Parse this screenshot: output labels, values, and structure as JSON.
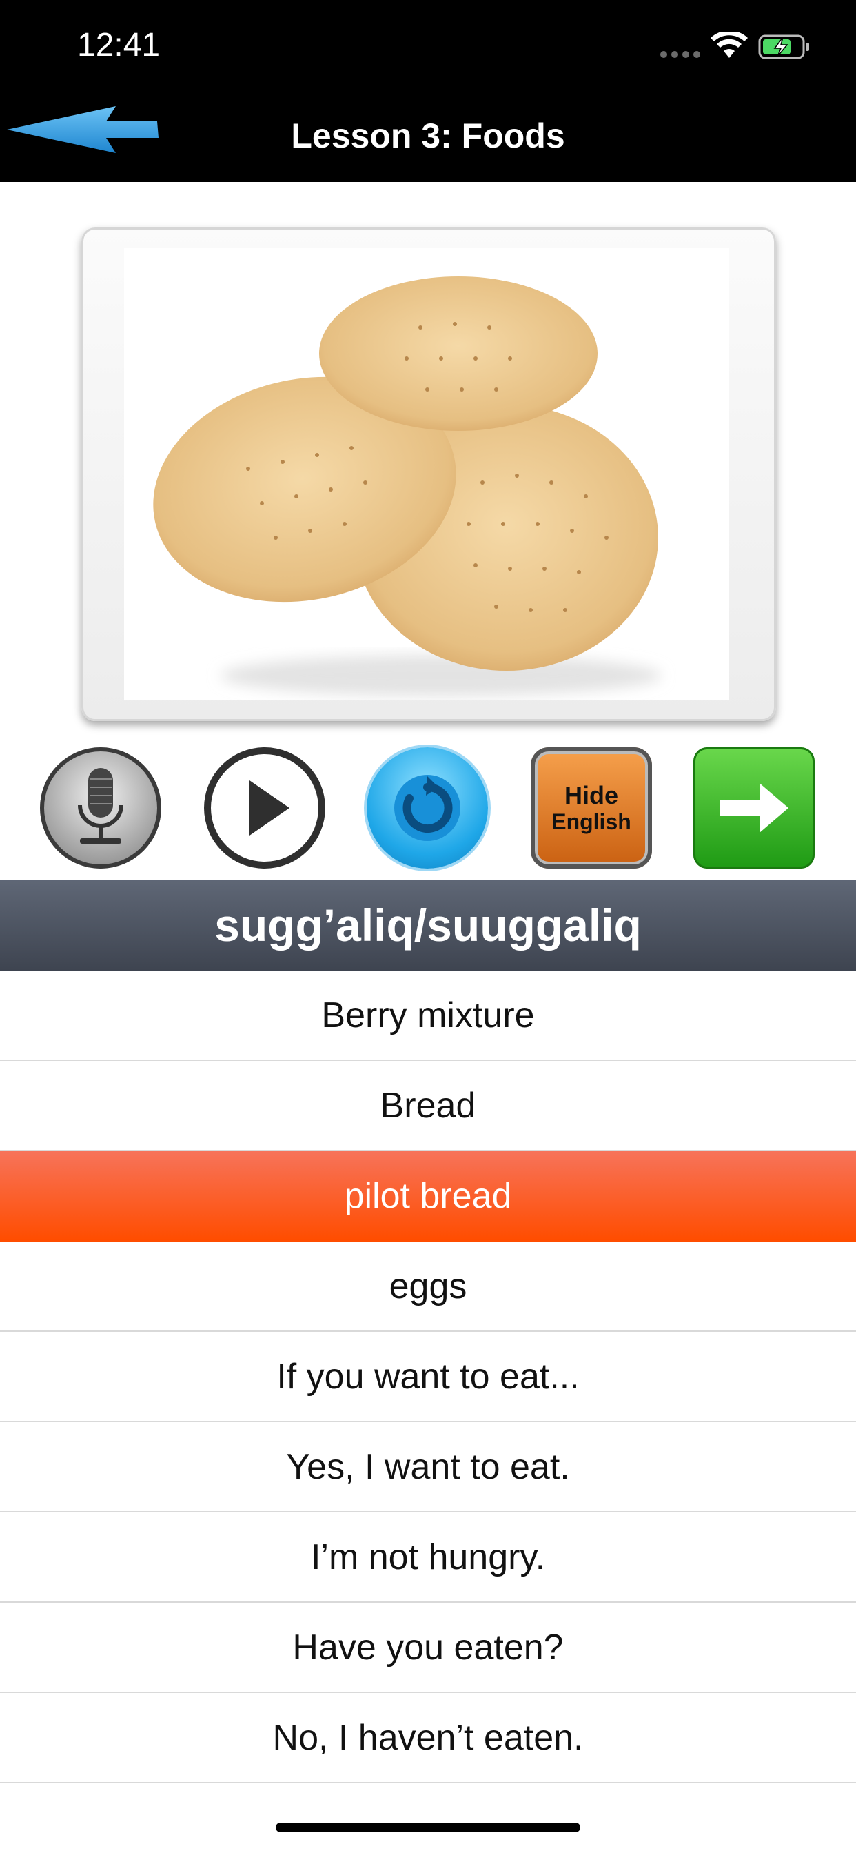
{
  "status_bar": {
    "time": "12:41"
  },
  "nav": {
    "title": "Lesson 3: Foods",
    "back_icon": "back-arrow-icon"
  },
  "photo": {
    "subject": "pilot-bread-crackers-image"
  },
  "controls": {
    "record_icon": "microphone-icon",
    "play_icon": "play-icon",
    "replay_icon": "replay-icon",
    "hide_line1": "Hide",
    "hide_line2": "English",
    "next_icon": "arrow-right-icon"
  },
  "word": "sugg’aliq/suuggaliq",
  "items": [
    {
      "label": "Berry mixture",
      "selected": false
    },
    {
      "label": "Bread",
      "selected": false
    },
    {
      "label": "pilot bread",
      "selected": true
    },
    {
      "label": "eggs",
      "selected": false
    },
    {
      "label": "If you want to eat...",
      "selected": false
    },
    {
      "label": "Yes, I want to eat.",
      "selected": false
    },
    {
      "label": "I’m not hungry.",
      "selected": false
    },
    {
      "label": "Have you eaten?",
      "selected": false
    },
    {
      "label": "No, I haven’t eaten.",
      "selected": false
    }
  ],
  "colors": {
    "selected_row": "#ff4d00",
    "header_bg": "#4a505c",
    "next_green": "#2fb21c",
    "replay_blue": "#1fa7e8",
    "hide_orange": "#e07a20"
  }
}
